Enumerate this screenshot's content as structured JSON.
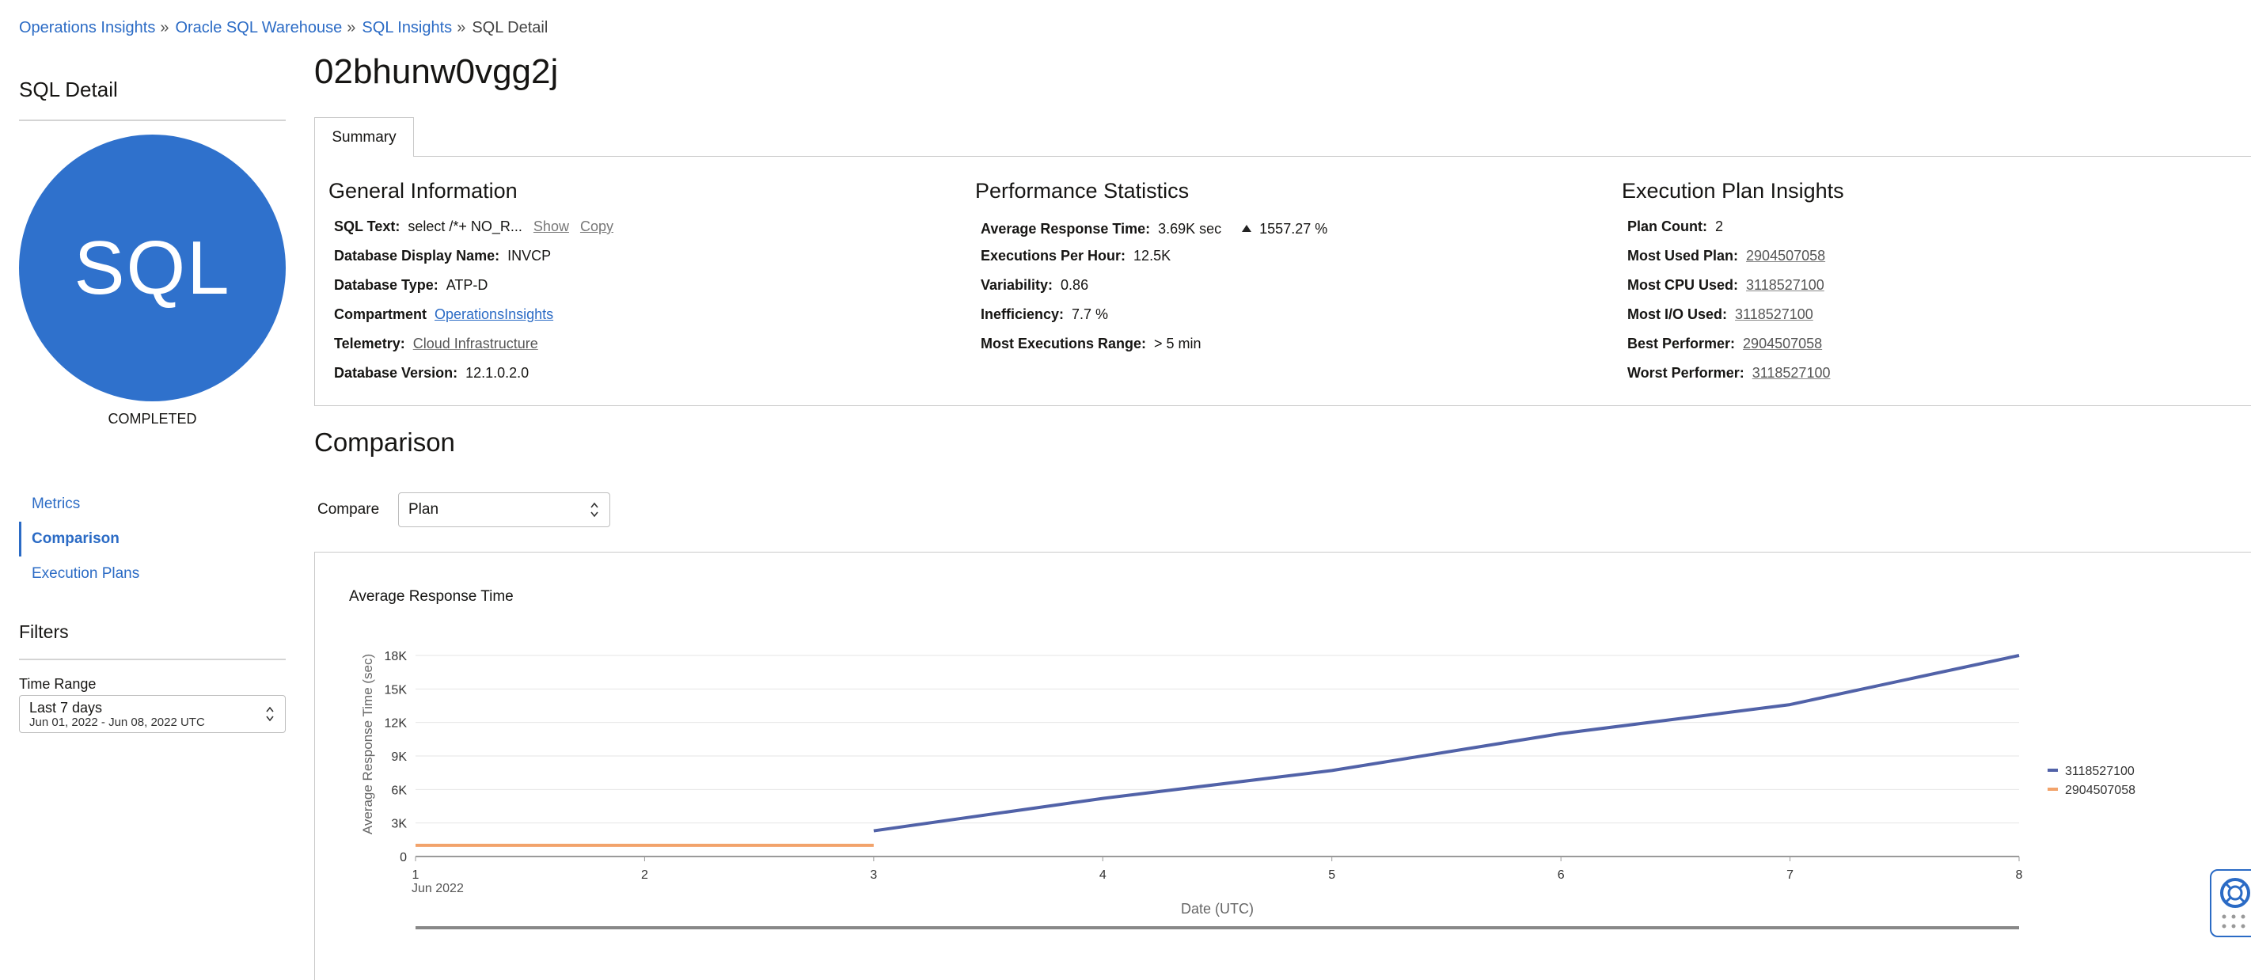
{
  "breadcrumb": {
    "items": [
      "Operations Insights",
      "Oracle SQL Warehouse",
      "SQL Insights"
    ],
    "sep": "»",
    "current": "SQL Detail"
  },
  "sidebar": {
    "title": "SQL Detail",
    "avatar_text": "SQL",
    "status": "COMPLETED",
    "nav": [
      {
        "label": "Metrics",
        "active": false
      },
      {
        "label": "Comparison",
        "active": true
      },
      {
        "label": "Execution Plans",
        "active": false
      }
    ],
    "filters": {
      "title": "Filters",
      "time_range_label": "Time Range",
      "time_range_value": "Last 7 days",
      "time_range_sub": "Jun 01, 2022 - Jun 08, 2022 UTC"
    }
  },
  "main": {
    "title": "02bhunw0vgg2j",
    "tab": "Summary",
    "general": {
      "title": "General Information",
      "sql_text_label": "SQL Text:",
      "sql_text_value": "select /*+ NO_R...",
      "show": "Show",
      "copy": "Copy",
      "db_display_name_label": "Database Display Name:",
      "db_display_name_value": "INVCP",
      "db_type_label": "Database Type:",
      "db_type_value": "ATP-D",
      "compartment_label": "Compartment",
      "compartment_value": "OperationsInsights",
      "telemetry_label": "Telemetry:",
      "telemetry_value": "Cloud Infrastructure",
      "db_version_label": "Database Version:",
      "db_version_value": "12.1.0.2.0"
    },
    "performance": {
      "title": "Performance Statistics",
      "avg_resp_label": "Average Response Time:",
      "avg_resp_value": "3.69K sec",
      "avg_resp_delta": "1557.27 %",
      "exec_per_hour_label": "Executions Per Hour:",
      "exec_per_hour_value": "12.5K",
      "variability_label": "Variability:",
      "variability_value": "0.86",
      "inefficiency_label": "Inefficiency:",
      "inefficiency_value": "7.7 %",
      "most_exec_range_label": "Most Executions Range:",
      "most_exec_range_value": "> 5 min"
    },
    "plan_insights": {
      "title": "Execution Plan Insights",
      "plan_count_label": "Plan Count:",
      "plan_count_value": "2",
      "most_used_label": "Most Used Plan:",
      "most_used_value": "2904507058",
      "most_cpu_label": "Most CPU Used:",
      "most_cpu_value": "3118527100",
      "most_io_label": "Most I/O Used:",
      "most_io_value": "3118527100",
      "best_label": "Best Performer:",
      "best_value": "2904507058",
      "worst_label": "Worst Performer:",
      "worst_value": "3118527100"
    },
    "comparison": {
      "title": "Comparison",
      "compare_label": "Compare",
      "compare_value": "Plan"
    }
  },
  "colors": {
    "accent": "#2b6bc5",
    "avatar": "#2f71cc",
    "series_1": "#5162a8",
    "series_2": "#f2a36b"
  },
  "chart_data": {
    "type": "line",
    "title": "Average Response Time",
    "xlabel": "Date (UTC)",
    "ylabel": "Average Response Time (sec)",
    "x_ticks": [
      "1",
      "2",
      "3",
      "4",
      "5",
      "6",
      "7",
      "8"
    ],
    "x_sub_label": "Jun 2022",
    "ylim": [
      0,
      18000
    ],
    "y_ticks": [
      {
        "v": 0,
        "label": "0"
      },
      {
        "v": 3000,
        "label": "3K"
      },
      {
        "v": 6000,
        "label": "6K"
      },
      {
        "v": 9000,
        "label": "9K"
      },
      {
        "v": 12000,
        "label": "12K"
      },
      {
        "v": 15000,
        "label": "15K"
      },
      {
        "v": 18000,
        "label": "18K"
      }
    ],
    "grid": true,
    "legend": "right",
    "series": [
      {
        "name": "3118527100",
        "color": "#5162a8",
        "x": [
          3,
          4,
          5,
          6,
          7,
          8
        ],
        "values": [
          2300,
          5200,
          7700,
          11000,
          13600,
          18000
        ]
      },
      {
        "name": "2904507058",
        "color": "#f2a36b",
        "x": [
          1,
          2,
          3
        ],
        "values": [
          1000,
          1000,
          1000
        ]
      }
    ]
  }
}
